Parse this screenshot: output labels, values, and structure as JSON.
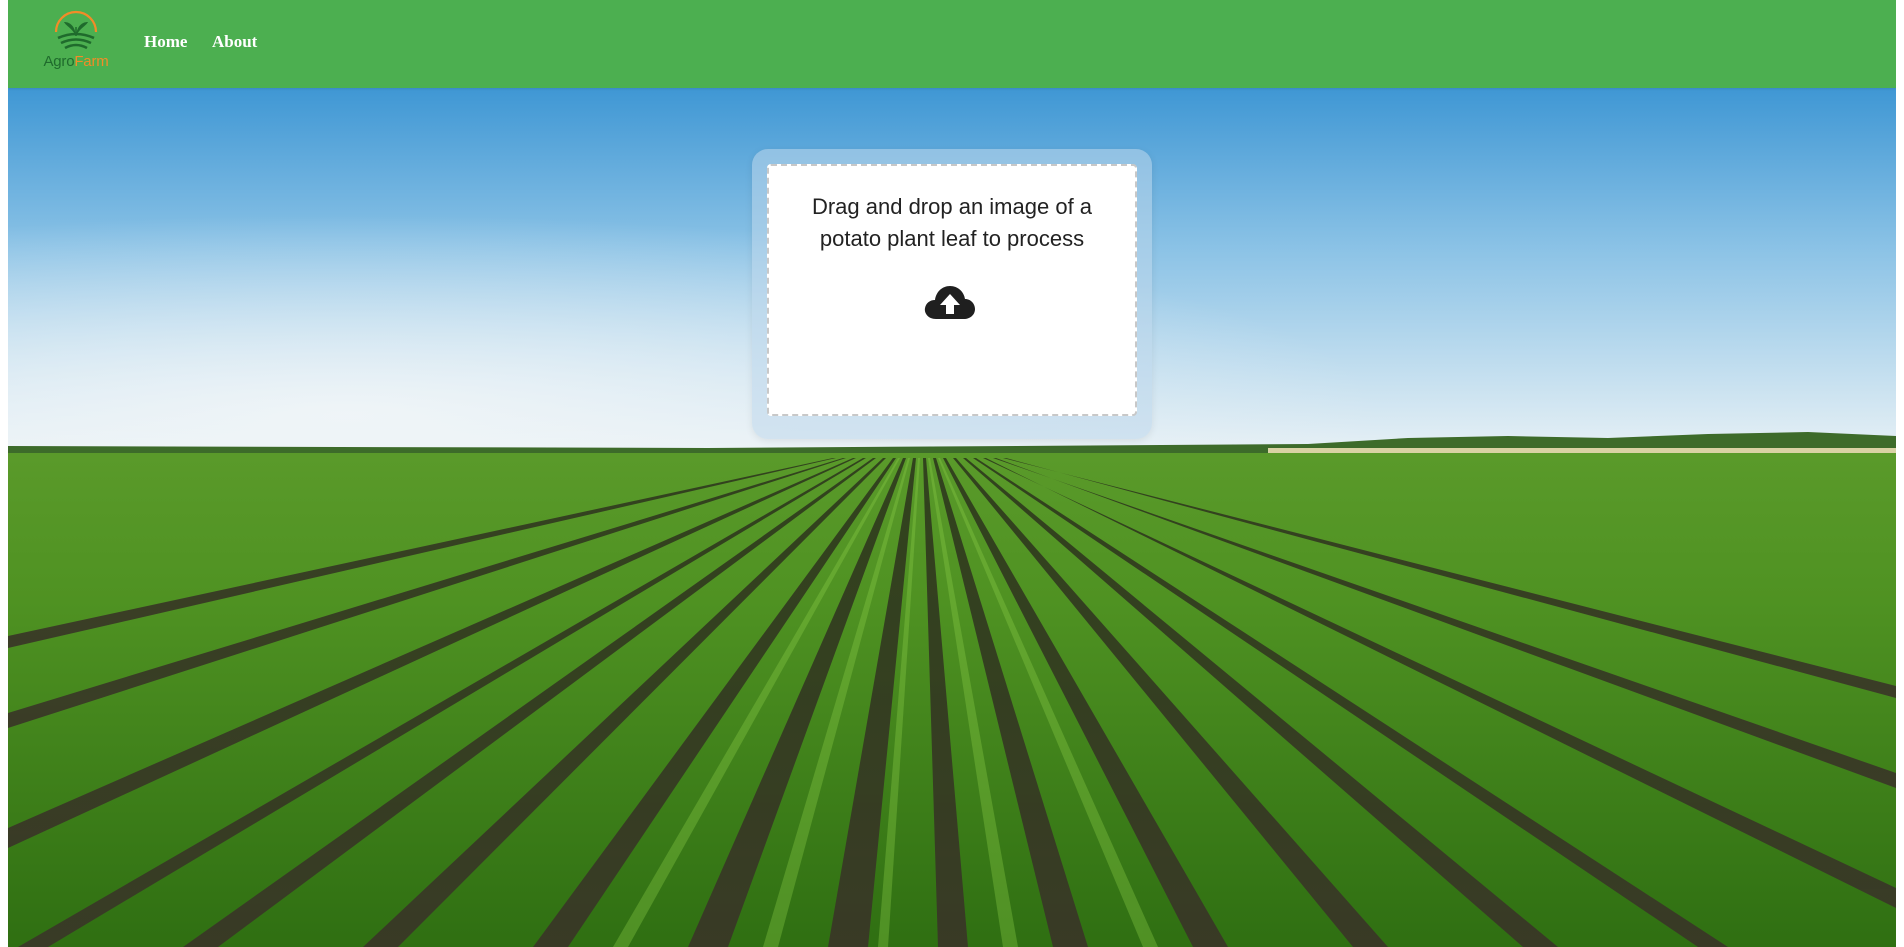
{
  "brand": {
    "logo_icon": "leaf-sun-logo-icon",
    "name_part1": "Agro",
    "name_part2": "Farm",
    "color_part1": "#1f6b2c",
    "color_part2": "#f28c28"
  },
  "nav": {
    "background": "#4caf50",
    "items": [
      {
        "label": "Home"
      },
      {
        "label": "About"
      }
    ]
  },
  "hero": {
    "background_image": "green-crop-field-under-blue-sky"
  },
  "upload": {
    "instruction": "Drag and drop an image of a potato plant leaf to process",
    "icon": "cloud-upload-icon"
  }
}
